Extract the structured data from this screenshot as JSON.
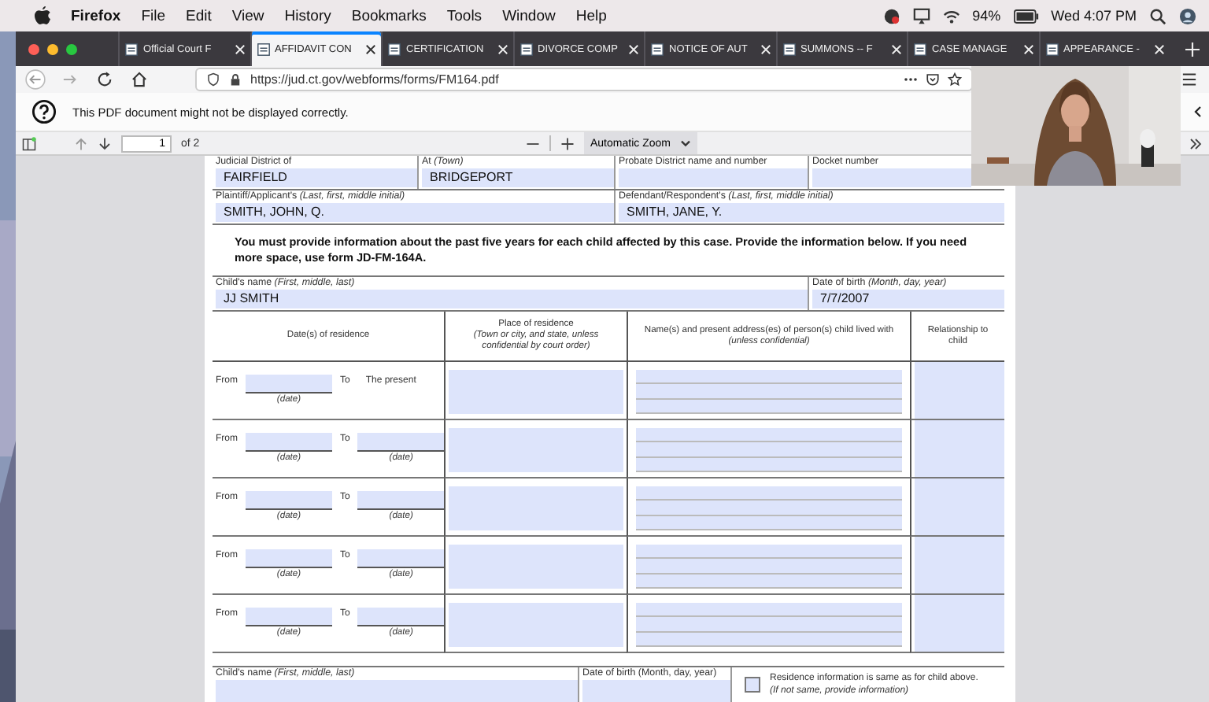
{
  "menubar": {
    "app": "Firefox",
    "menus": [
      "File",
      "Edit",
      "View",
      "History",
      "Bookmarks",
      "Tools",
      "Window",
      "Help"
    ],
    "battery": "94%",
    "clock": "Wed 4:07 PM"
  },
  "tabs": [
    {
      "label": "Official Court F",
      "selected": false
    },
    {
      "label": "AFFIDAVIT CON",
      "selected": true
    },
    {
      "label": "CERTIFICATION",
      "selected": false
    },
    {
      "label": "DIVORCE COMP",
      "selected": false
    },
    {
      "label": "NOTICE OF AUT",
      "selected": false
    },
    {
      "label": "SUMMONS -- F",
      "selected": false
    },
    {
      "label": "CASE MANAGE",
      "selected": false
    },
    {
      "label": "APPEARANCE -",
      "selected": false
    }
  ],
  "address_bar": {
    "url": "https://jud.ct.gov/webforms/forms/FM164.pdf"
  },
  "notification": "This PDF document might not be displayed correctly.",
  "pdf_toolbar": {
    "page": "1",
    "page_count": "of 2",
    "zoom": "Automatic Zoom"
  },
  "form": {
    "court_row": [
      {
        "label": "Judicial District of",
        "value": "FAIRFIELD"
      },
      {
        "label": "At *(Town)*",
        "value": "BRIDGEPORT"
      },
      {
        "label": "Probate District name and number"
      },
      {
        "label": "Docket number"
      }
    ],
    "parties_row": [
      {
        "label": "Plaintiff/Applicant's *(Last, first, middle initial)*",
        "value": "SMITH, JOHN, Q."
      },
      {
        "label": "Defendant/Respondent's *(Last, first, middle initial)*",
        "value": "SMITH, JANE, Y."
      }
    ],
    "instructions": "You must provide information about the past five years for each child affected by this case. Provide the information below. If you need more space, use form JD-FM-164A.",
    "child": {
      "name_label": "Child's name *(First, middle, last)*",
      "name": "JJ SMITH",
      "dob_label": "Date of birth *(Month, day, year)*",
      "dob": "7/7/2007"
    },
    "columns": [
      {
        "title": "Date(s) of residence"
      },
      {
        "title": "Place of residence",
        "note": "(Town or city, and state, unless confidential by court order)"
      },
      {
        "title": "Name(s) and present address(es) of person(s) child lived with",
        "note": "(unless confidential)"
      },
      {
        "title": "Relationship to child"
      }
    ],
    "residences": [
      {
        "kind": "present",
        "from_label": "From",
        "from_caption": "(date)",
        "to_label": "To",
        "to_text": "The present"
      },
      {
        "kind": "range",
        "from_label": "From",
        "from_caption": "(date)",
        "to_label": "To",
        "to_caption": "(date)"
      },
      {
        "kind": "range",
        "from_label": "From",
        "from_caption": "(date)",
        "to_label": "To",
        "to_caption": "(date)"
      },
      {
        "kind": "range",
        "from_label": "From",
        "from_caption": "(date)",
        "to_label": "To",
        "to_caption": "(date)"
      },
      {
        "kind": "range",
        "from_label": "From",
        "from_caption": "(date)",
        "to_label": "To",
        "to_caption": "(date)"
      }
    ],
    "next_child": {
      "name_label": "Child's name *(First, middle, last)*",
      "dob_label": "Date of birth (Month, day, year)",
      "same_checked": false,
      "same_label": "Residence information is same as for child above.",
      "same_note": "(If not same, provide information)"
    }
  }
}
